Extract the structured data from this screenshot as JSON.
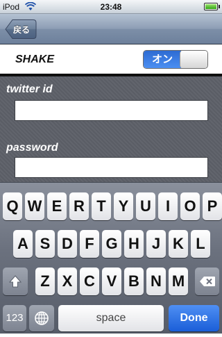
{
  "status_bar": {
    "carrier": "iPod",
    "time": "23:48",
    "wifi_icon": "wifi-icon",
    "battery_icon": "battery-icon"
  },
  "nav": {
    "back_label": "戻る"
  },
  "settings": {
    "shake_label": "SHAKE",
    "switch_label": "オン",
    "switch_on": true
  },
  "form": {
    "twitter_label": "twitter id",
    "twitter_value": "",
    "password_label": "password",
    "password_value": ""
  },
  "keyboard": {
    "row1": [
      "Q",
      "W",
      "E",
      "R",
      "T",
      "Y",
      "U",
      "I",
      "O",
      "P"
    ],
    "row2": [
      "A",
      "S",
      "D",
      "F",
      "G",
      "H",
      "J",
      "K",
      "L"
    ],
    "row3": [
      "Z",
      "X",
      "C",
      "V",
      "B",
      "N",
      "M"
    ],
    "numbers_label": "123",
    "space_label": "space",
    "done_label": "Done",
    "shift_icon": "shift-icon",
    "delete_icon": "delete-icon",
    "globe_icon": "globe-icon"
  },
  "colors": {
    "accent_blue": "#2d6bd2",
    "form_background": "#5d6068",
    "keyboard_background": "#6b717e"
  }
}
